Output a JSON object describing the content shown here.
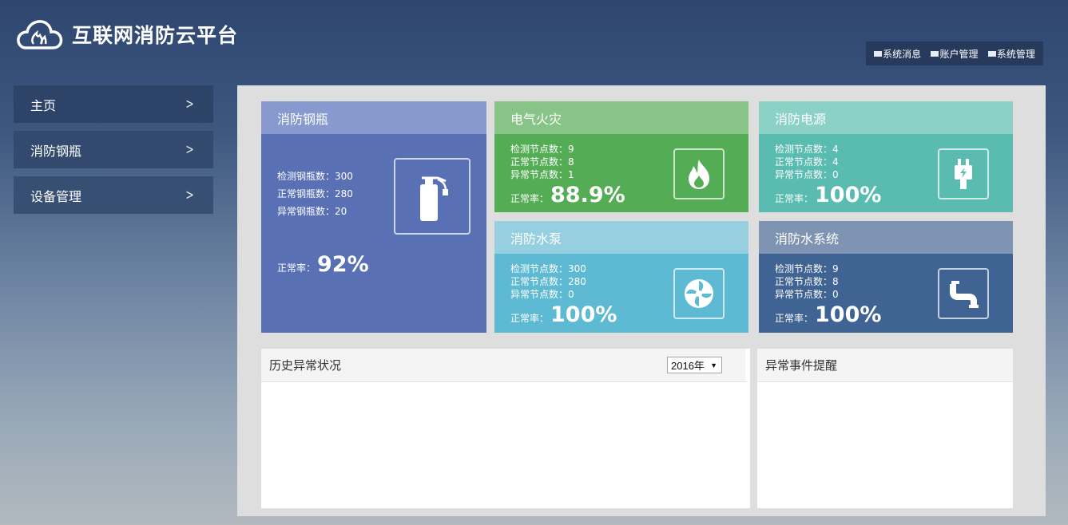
{
  "app": {
    "title": "互联网消防云平台"
  },
  "colors": {
    "accent": "#2e4670",
    "card_blue": "#5970b5",
    "card_green": "#54ad54",
    "card_teal": "#5abcb0",
    "card_sky": "#5ebad3",
    "card_navy": "#3f6392"
  },
  "topnav": [
    {
      "label": "系统消息",
      "icon": "mail-icon"
    },
    {
      "label": "账户管理",
      "icon": "mail-icon"
    },
    {
      "label": "系统管理",
      "icon": "mail-icon"
    }
  ],
  "sidebar": {
    "items": [
      {
        "label": "主页",
        "icon": "chevron-right-icon"
      },
      {
        "label": "消防钢瓶",
        "icon": "chevron-right-icon"
      },
      {
        "label": "设备管理",
        "icon": "chevron-right-icon"
      }
    ]
  },
  "cards": {
    "cylinder": {
      "title": "消防钢瓶",
      "stats": [
        "检测钢瓶数：300",
        "正常钢瓶数：280",
        "异常钢瓶数：20"
      ],
      "rate_label": "正常率：",
      "rate_value": "92%",
      "icon": "fire-extinguisher-icon"
    },
    "electrical": {
      "title": "电气火灾",
      "stats": [
        "检测节点数：9",
        "正常节点数：8",
        "异常节点数：1"
      ],
      "rate_label": "正常率：",
      "rate_value": "88.9%",
      "icon": "flame-icon"
    },
    "power": {
      "title": "消防电源",
      "stats": [
        "检测节点数：4",
        "正常节点数：4",
        "异常节点数：0"
      ],
      "rate_label": "正常率：",
      "rate_value": "100%",
      "icon": "plug-icon"
    },
    "pump": {
      "title": "消防水泵",
      "stats": [
        "检测节点数：300",
        "正常节点数：280",
        "异常节点数：0"
      ],
      "rate_label": "正常率：",
      "rate_value": "100%",
      "icon": "fan-icon"
    },
    "water": {
      "title": "消防水系统",
      "stats": [
        "检测节点数：9",
        "正常节点数：8",
        "异常节点数：0"
      ],
      "rate_label": "正常率：",
      "rate_value": "100%",
      "icon": "pipe-icon"
    }
  },
  "history": {
    "title": "历史异常状况",
    "year_selected": "2016年"
  },
  "alerts": {
    "title": "异常事件提醒"
  }
}
